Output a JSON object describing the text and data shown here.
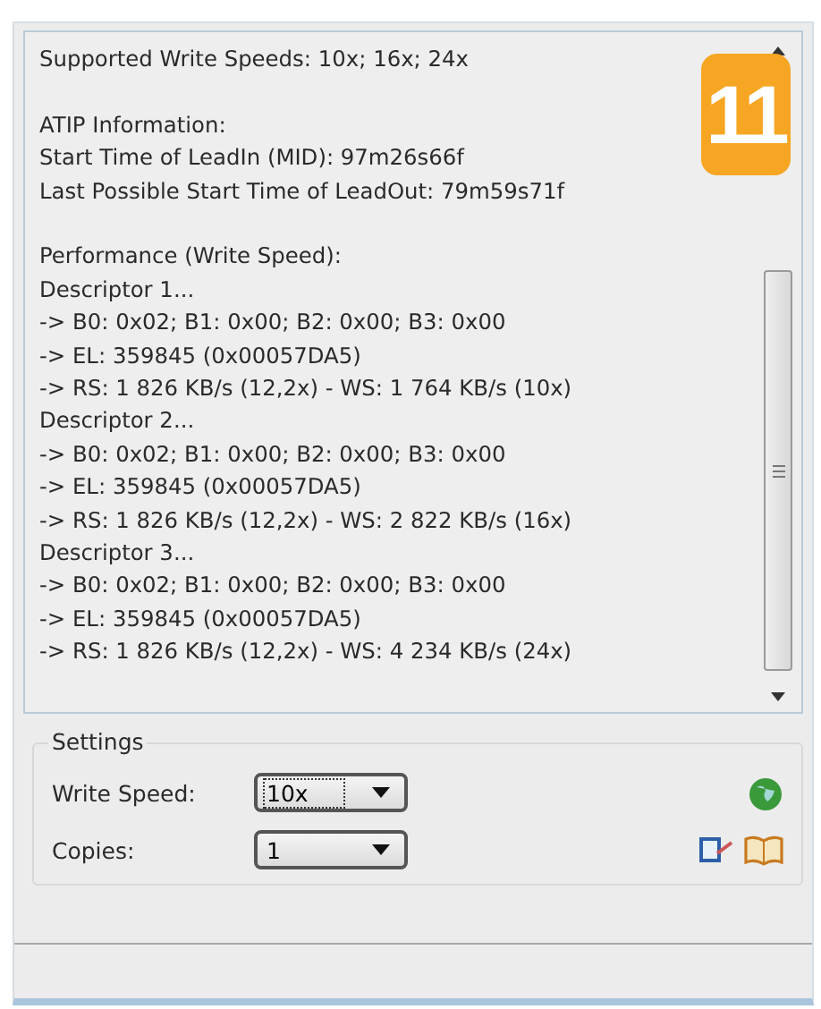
{
  "info_blocks": [
    [
      "Supported Write Speeds: 10x; 16x; 24x"
    ],
    [
      "ATIP Information:",
      "Start Time of LeadIn (MID): 97m26s66f",
      "Last Possible Start Time of LeadOut: 79m59s71f"
    ],
    [
      "Performance (Write Speed):",
      "Descriptor 1...",
      "-> B0: 0x02; B1: 0x00; B2: 0x00; B3: 0x00",
      "-> EL: 359845 (0x00057DA5)",
      "-> RS: 1 826 KB/s (12,2x) - WS: 1 764 KB/s (10x)",
      "Descriptor 2...",
      "-> B0: 0x02; B1: 0x00; B2: 0x00; B3: 0x00",
      "-> EL: 359845 (0x00057DA5)",
      "-> RS: 1 826 KB/s (12,2x) - WS: 2 822 KB/s (16x)",
      "Descriptor 3...",
      "-> B0: 0x02; B1: 0x00; B2: 0x00; B3: 0x00",
      "-> EL: 359845 (0x00057DA5)",
      "-> RS: 1 826 KB/s (12,2x) - WS: 4 234 KB/s (24x)"
    ]
  ],
  "step_badge": "11",
  "settings": {
    "title": "Settings",
    "fields": [
      {
        "label": "Write Speed:",
        "value": "10x",
        "focused": true
      },
      {
        "label": "Copies:",
        "value": "1",
        "focused": false
      }
    ]
  }
}
